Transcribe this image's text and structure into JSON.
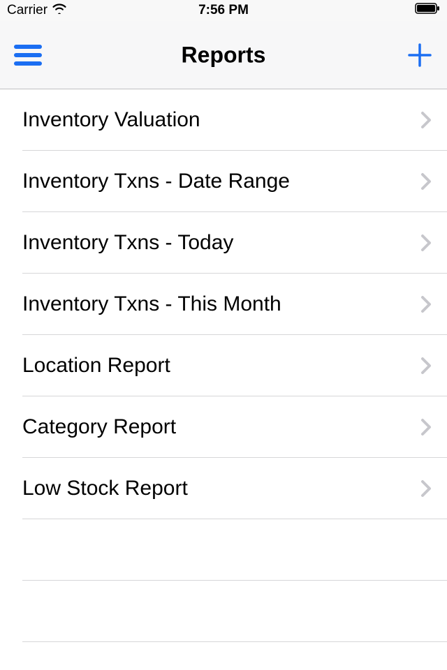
{
  "status_bar": {
    "carrier": "Carrier",
    "time": "7:56 PM"
  },
  "nav": {
    "title": "Reports"
  },
  "reports": [
    {
      "label": "Inventory Valuation"
    },
    {
      "label": "Inventory Txns - Date Range"
    },
    {
      "label": "Inventory Txns - Today"
    },
    {
      "label": "Inventory Txns - This Month"
    },
    {
      "label": "Location Report"
    },
    {
      "label": "Category Report"
    },
    {
      "label": "Low Stock Report"
    }
  ]
}
